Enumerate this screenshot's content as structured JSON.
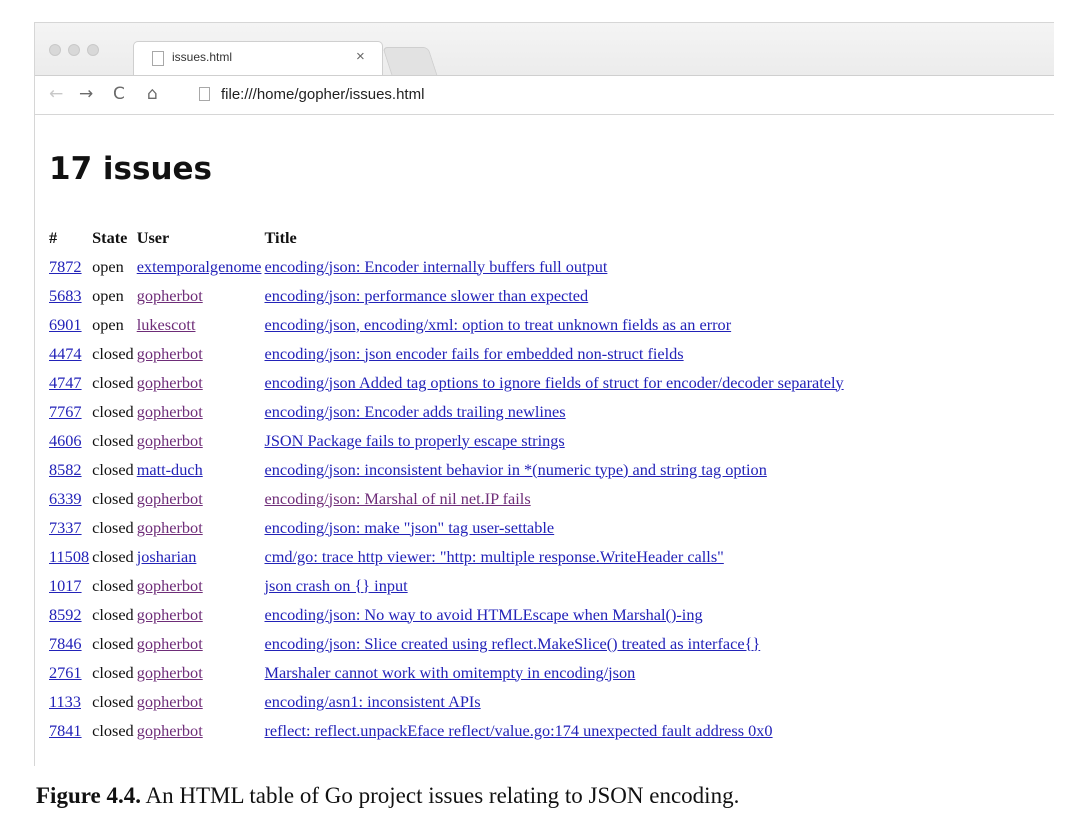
{
  "browser": {
    "tab_title": "issues.html",
    "tab_close": "×",
    "url": "file:///home/gopher/issues.html",
    "nav": {
      "back": "←",
      "forward": "→",
      "reload": "C",
      "home": "⌂"
    }
  },
  "page": {
    "heading": "17 issues",
    "columns": [
      "#",
      "State",
      "User",
      "Title"
    ],
    "issues": [
      {
        "number": "7872",
        "state": "open",
        "user": "extemporalgenome",
        "title": "encoding/json: Encoder internally buffers full output"
      },
      {
        "number": "5683",
        "state": "open",
        "user": "gopherbot",
        "title": "encoding/json: performance slower than expected"
      },
      {
        "number": "6901",
        "state": "open",
        "user": "lukescott",
        "title": "encoding/json, encoding/xml: option to treat unknown fields as an error"
      },
      {
        "number": "4474",
        "state": "closed",
        "user": "gopherbot",
        "title": "encoding/json: json encoder fails for embedded non-struct fields"
      },
      {
        "number": "4747",
        "state": "closed",
        "user": "gopherbot",
        "title": "encoding/json Added tag options to ignore fields of struct for encoder/decoder separately"
      },
      {
        "number": "7767",
        "state": "closed",
        "user": "gopherbot",
        "title": "encoding/json: Encoder adds trailing newlines"
      },
      {
        "number": "4606",
        "state": "closed",
        "user": "gopherbot",
        "title": "JSON Package fails to properly escape strings"
      },
      {
        "number": "8582",
        "state": "closed",
        "user": "matt-duch",
        "title": "encoding/json: inconsistent behavior in *(numeric type) and string tag option"
      },
      {
        "number": "6339",
        "state": "closed",
        "user": "gopherbot",
        "title": "encoding/json: Marshal of nil net.IP fails"
      },
      {
        "number": "7337",
        "state": "closed",
        "user": "gopherbot",
        "title": "encoding/json: make \"json\" tag user-settable"
      },
      {
        "number": "11508",
        "state": "closed",
        "user": "josharian",
        "title": "cmd/go: trace http viewer: \"http: multiple response.WriteHeader calls\""
      },
      {
        "number": "1017",
        "state": "closed",
        "user": "gopherbot",
        "title": "json crash on {} input"
      },
      {
        "number": "8592",
        "state": "closed",
        "user": "gopherbot",
        "title": "encoding/json: No way to avoid HTMLEscape when Marshal()-ing"
      },
      {
        "number": "7846",
        "state": "closed",
        "user": "gopherbot",
        "title": "encoding/json: Slice created using reflect.MakeSlice() treated as interface{}"
      },
      {
        "number": "2761",
        "state": "closed",
        "user": "gopherbot",
        "title": "Marshaler cannot work with omitempty in encoding/json"
      },
      {
        "number": "1133",
        "state": "closed",
        "user": "gopherbot",
        "title": "encoding/asn1: inconsistent APIs"
      },
      {
        "number": "7841",
        "state": "closed",
        "user": "gopherbot",
        "title": "reflect: reflect.unpackEface reflect/value.go:174 unexpected fault address 0x0"
      }
    ]
  },
  "caption": {
    "label": "Figure 4.4.",
    "text": "An HTML table of Go project issues relating to JSON encoding."
  },
  "colors": {
    "link": "#2222b8",
    "visited_link": "#6e2c78"
  }
}
